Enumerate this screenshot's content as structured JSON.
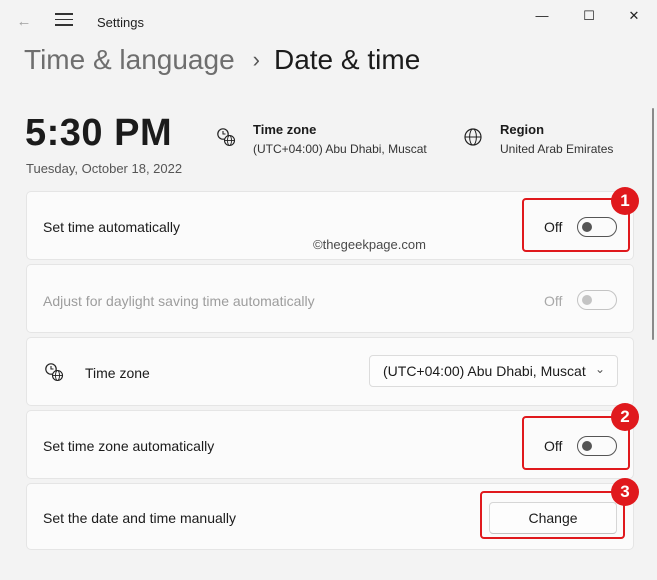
{
  "window": {
    "title": "Settings",
    "back_icon": "←",
    "minimize_icon": "—",
    "maximize_icon": "☐",
    "close_icon": "✕"
  },
  "breadcrumb": {
    "parent": "Time & language",
    "separator": "›",
    "current": "Date & time"
  },
  "summary": {
    "time": "5:30 PM",
    "date": "Tuesday, October 18, 2022",
    "timezone_title": "Time zone",
    "timezone_value": "(UTC+04:00) Abu Dhabi, Muscat",
    "region_title": "Region",
    "region_value": "United Arab Emirates"
  },
  "settings": {
    "set_time_auto": {
      "label": "Set time automatically",
      "state": "Off"
    },
    "daylight_saving": {
      "label": "Adjust for daylight saving time automatically",
      "state": "Off"
    },
    "time_zone": {
      "label": "Time zone",
      "value": "(UTC+04:00) Abu Dhabi, Muscat",
      "chevron": "⌄"
    },
    "set_tz_auto": {
      "label": "Set time zone automatically",
      "state": "Off"
    },
    "manual": {
      "label": "Set the date and time manually",
      "button": "Change"
    }
  },
  "annotations": {
    "badge1": "1",
    "badge2": "2",
    "badge3": "3",
    "color": "#e0191d"
  },
  "watermark": "©thegeekpage.com"
}
